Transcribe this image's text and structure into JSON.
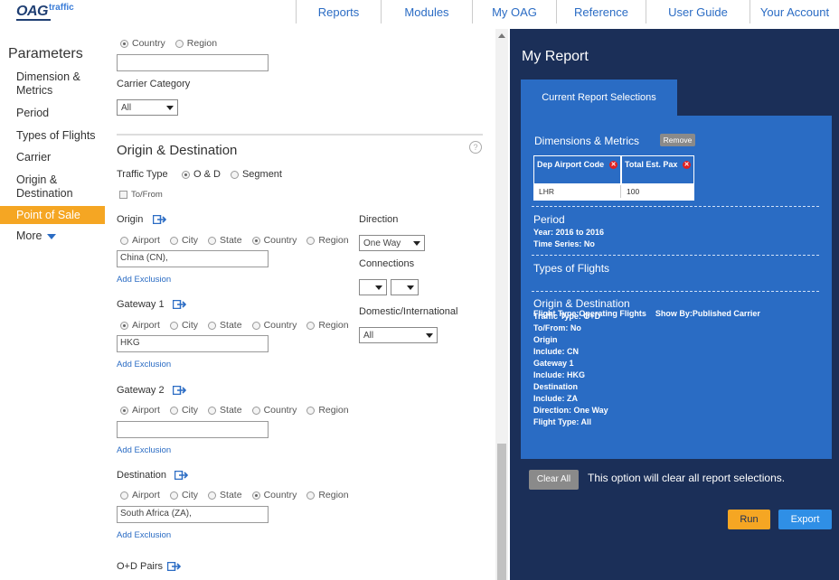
{
  "logo": {
    "brand": "OAG",
    "product": "traffic"
  },
  "nav": [
    "Reports",
    "Modules",
    "My OAG",
    "Reference",
    "User Guide",
    "Your Account"
  ],
  "sidebar": {
    "title": "Parameters",
    "items": [
      {
        "label": "Dimension &",
        "label2": "Metrics"
      },
      {
        "label": "Period"
      },
      {
        "label": "Types of Flights"
      },
      {
        "label": "Carrier"
      },
      {
        "label": "Origin &",
        "label2": "Destination"
      },
      {
        "label": "Point of Sale",
        "active": true
      },
      {
        "label": "More"
      }
    ]
  },
  "form": {
    "top_radios": {
      "country": "Country",
      "region": "Region",
      "selected": "Country"
    },
    "top_input_value": "",
    "carrier_category": {
      "label": "Carrier Category",
      "value": "All"
    },
    "od": {
      "title": "Origin & Destination",
      "help": "?",
      "traffic_type_label": "Traffic Type",
      "traffic_od": "O & D",
      "traffic_segment": "Segment",
      "traffic_selected": "O & D",
      "tofrom": "To/From"
    },
    "radio_labels": {
      "airport": "Airport",
      "city": "City",
      "state": "State",
      "country": "Country",
      "region": "Region"
    },
    "add_exclusion": "Add Exclusion",
    "origin": {
      "label": "Origin",
      "value": "China (CN),",
      "selected": "Country"
    },
    "gateway1": {
      "label": "Gateway 1",
      "value": "HKG",
      "selected": "Airport"
    },
    "gateway2": {
      "label": "Gateway 2",
      "value": "",
      "selected": "Airport"
    },
    "destination": {
      "label": "Destination",
      "value": "South Africa (ZA),",
      "selected": "Country"
    },
    "od_pairs": "O+D Pairs",
    "direction": {
      "label": "Direction",
      "value": "One Way"
    },
    "connections": {
      "label": "Connections"
    },
    "domestic": {
      "label": "Domestic/International",
      "value": "All"
    }
  },
  "report": {
    "title": "My Report",
    "tab": "Current Report Selections",
    "dimensions": {
      "title": "Dimensions & Metrics",
      "remove": "Remove",
      "col1": "Dep Airport Code",
      "col2": "Total Est. Pax",
      "val1": "LHR",
      "val2": "100"
    },
    "period": {
      "title": "Period",
      "lines": [
        "Year: 2016  to 2016",
        "Time Series: No"
      ]
    },
    "types": {
      "title": "Types of Flights",
      "lines": [
        "Flight Type:Operating Flights    Show By:Published Carrier"
      ]
    },
    "od": {
      "title": "Origin & Destination",
      "lines": [
        "Traffic Type: O+D",
        "To/From: No",
        "Origin",
        "Include: CN",
        "Gateway 1",
        "Include: HKG",
        "Destination",
        "Include: ZA",
        "Direction: One Way",
        "Flight Type: All"
      ]
    },
    "clear_all": "Clear All",
    "clear_note": "This option will clear all report selections.",
    "run": "Run",
    "export": "Export"
  },
  "colors": {
    "navy": "#1b2f58",
    "blue": "#2a6cc4",
    "orange": "#f5a623",
    "link": "#2b6cc4"
  },
  "icons": [
    "export-arrow-icon",
    "close-x-icon",
    "help-icon",
    "chevron-down-icon"
  ]
}
